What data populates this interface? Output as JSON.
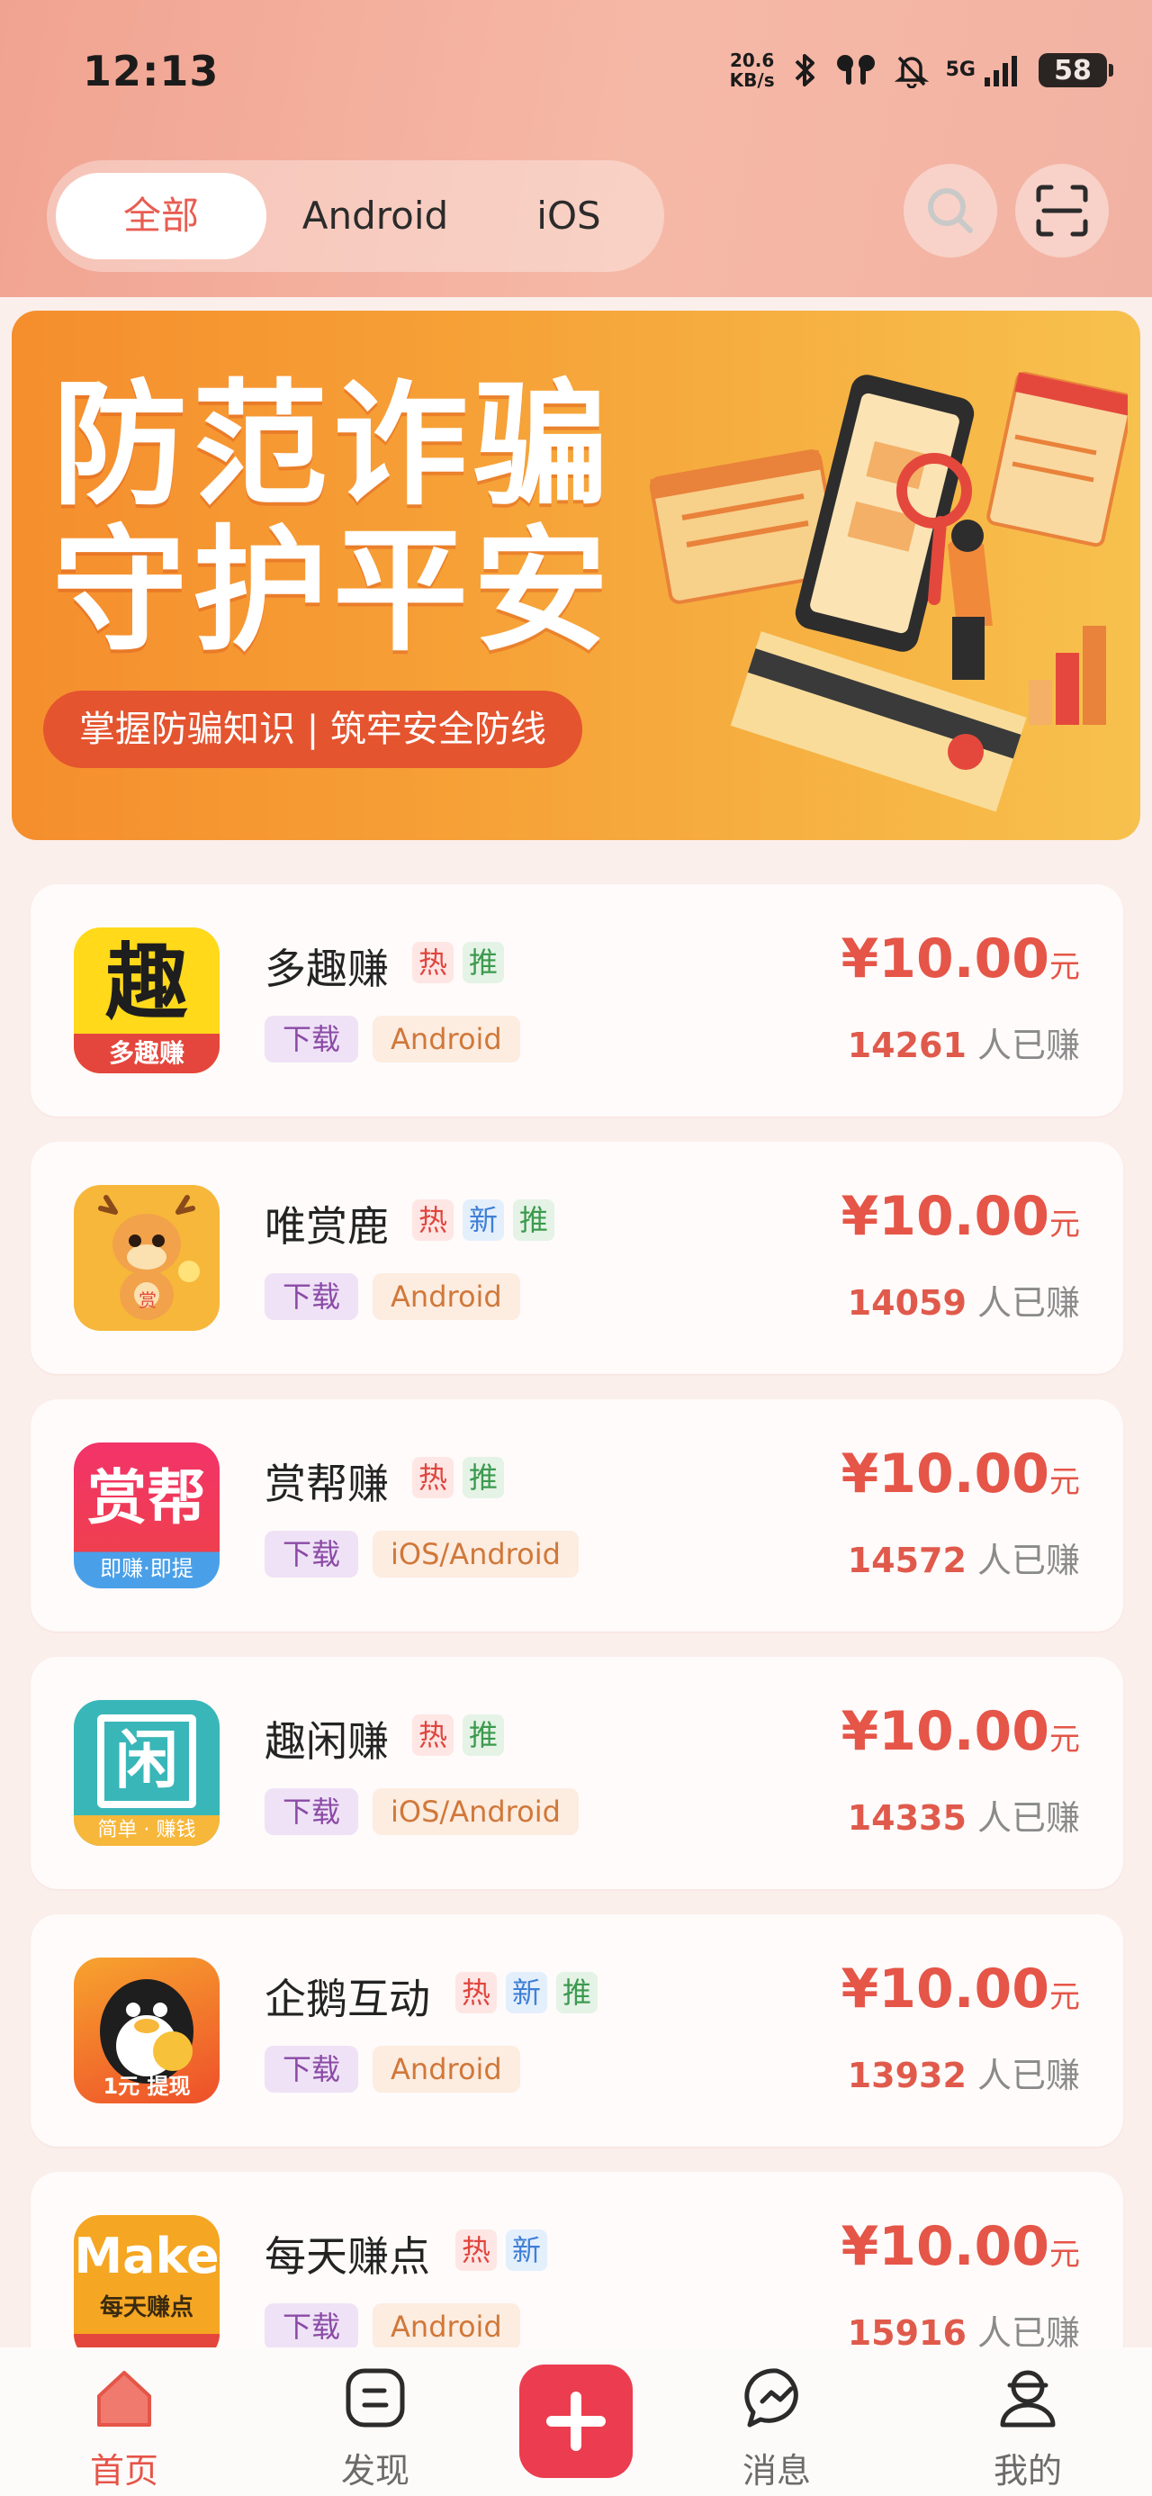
{
  "status_bar": {
    "time": "12:13",
    "net_speed_value": "20.6",
    "net_speed_unit": "KB/s",
    "net_type": "5G",
    "battery": "58",
    "icons": [
      "bluetooth-icon",
      "earbuds-icon",
      "mute-icon",
      "signal-icon",
      "battery-icon"
    ]
  },
  "header": {
    "tabs": [
      {
        "label": "全部",
        "active": true
      },
      {
        "label": "Android",
        "active": false
      },
      {
        "label": "iOS",
        "active": false
      }
    ],
    "actions": [
      "search-icon",
      "scan-icon"
    ]
  },
  "banner": {
    "line1": "防范诈骗",
    "line2": "守护平安",
    "subtitle": "掌握防骗知识 | 筑牢安全防线"
  },
  "apps": [
    {
      "name": "多趣赚",
      "tags": [
        "热",
        "推"
      ],
      "type": "下载",
      "platform": "Android",
      "price": "¥10.00",
      "unit": "元",
      "earned_count": "14261",
      "earned_label": "人已赚",
      "icon_text": "趣",
      "icon_caption": "多趣赚"
    },
    {
      "name": "唯赏鹿",
      "tags": [
        "热",
        "新",
        "推"
      ],
      "type": "下载",
      "platform": "Android",
      "price": "¥10.00",
      "unit": "元",
      "earned_count": "14059",
      "earned_label": "人已赚",
      "icon_text": "赏",
      "icon_caption": ""
    },
    {
      "name": "赏帮赚",
      "tags": [
        "热",
        "推"
      ],
      "type": "下载",
      "platform": "iOS/Android",
      "price": "¥10.00",
      "unit": "元",
      "earned_count": "14572",
      "earned_label": "人已赚",
      "icon_text": "赏帮",
      "icon_caption": "即赚·即提"
    },
    {
      "name": "趣闲赚",
      "tags": [
        "热",
        "推"
      ],
      "type": "下载",
      "platform": "iOS/Android",
      "price": "¥10.00",
      "unit": "元",
      "earned_count": "14335",
      "earned_label": "人已赚",
      "icon_text": "闲",
      "icon_caption": "简单 · 赚钱"
    },
    {
      "name": "企鹅互动",
      "tags": [
        "热",
        "新",
        "推"
      ],
      "type": "下载",
      "platform": "Android",
      "price": "¥10.00",
      "unit": "元",
      "earned_count": "13932",
      "earned_label": "人已赚",
      "icon_text": "",
      "icon_caption": "1元 提现"
    },
    {
      "name": "每天赚点",
      "tags": [
        "热",
        "新"
      ],
      "type": "下载",
      "platform": "Android",
      "price": "¥10.00",
      "unit": "元",
      "earned_count": "15916",
      "earned_label": "人已赚",
      "icon_text": "Make",
      "icon_caption": "每天赚点"
    }
  ],
  "bottom_nav": {
    "items": [
      {
        "label": "首页",
        "icon": "home-icon",
        "active": true
      },
      {
        "label": "发现",
        "icon": "discover-icon",
        "active": false
      },
      {
        "label": "消息",
        "icon": "message-icon",
        "active": false
      },
      {
        "label": "我的",
        "icon": "profile-icon",
        "active": false
      }
    ],
    "center_icon": "plus-icon"
  },
  "colors": {
    "accent": "#e55548",
    "header_gradient_start": "#f1a391",
    "header_gradient_end": "#f6b8a6",
    "plus_button": "#ec3c4f",
    "tag_hot": "#e0453e",
    "tag_new": "#3e7fd6",
    "tag_recommend": "#3c9a4e"
  }
}
